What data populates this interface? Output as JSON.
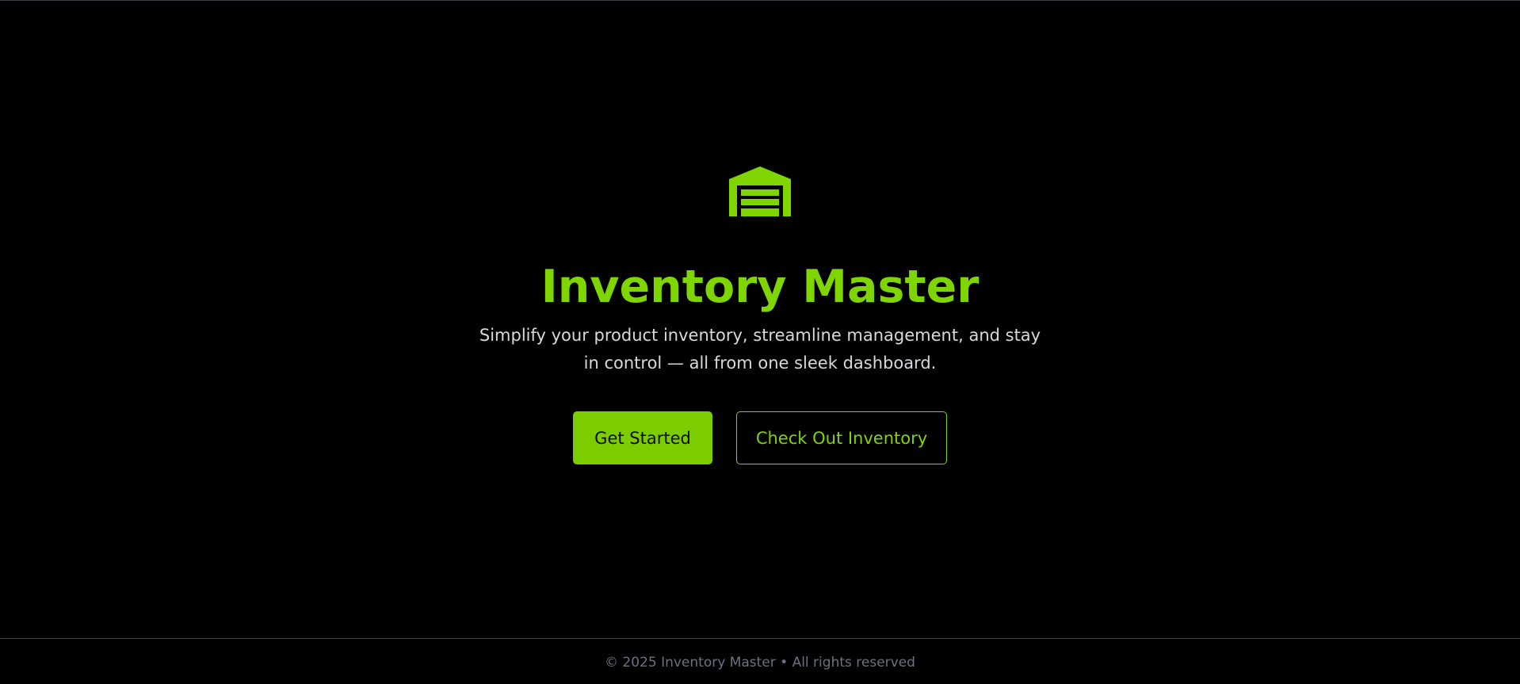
{
  "brand": {
    "icon": "warehouse-icon",
    "accent_color": "#7ed500",
    "title": "Inventory Master"
  },
  "hero": {
    "subtitle": "Simplify your product inventory, streamline management, and stay in control — all from one sleek dashboard."
  },
  "actions": {
    "primary_label": "Get Started",
    "secondary_label": "Check Out Inventory"
  },
  "footer": {
    "text": "© 2025 Inventory Master • All rights reserved"
  }
}
